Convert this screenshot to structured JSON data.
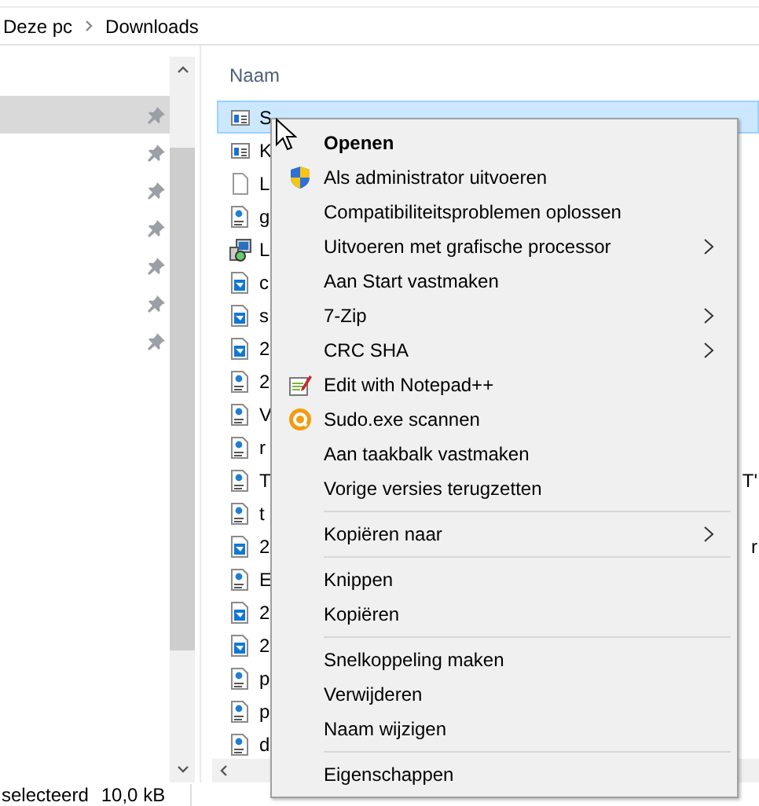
{
  "address_bar": {
    "path": [
      {
        "label": "Deze pc"
      },
      {
        "label": "Downloads"
      }
    ]
  },
  "navigation_pane": {
    "items": [
      {
        "selected": true
      },
      {
        "selected": false
      },
      {
        "selected": false
      },
      {
        "selected": false
      },
      {
        "selected": false
      },
      {
        "selected": false
      },
      {
        "selected": false
      }
    ]
  },
  "file_list": {
    "column_header": "Naam",
    "rows": [
      {
        "name": "S",
        "kind": "app",
        "selected": true
      },
      {
        "name": "K",
        "kind": "app",
        "selected": false
      },
      {
        "name": "L",
        "kind": "blank",
        "selected": false
      },
      {
        "name": "g",
        "kind": "pdf",
        "selected": false
      },
      {
        "name": "L",
        "kind": "installer",
        "selected": false
      },
      {
        "name": "c",
        "kind": "image",
        "selected": false
      },
      {
        "name": "s",
        "kind": "image",
        "selected": false
      },
      {
        "name": "2",
        "kind": "image",
        "selected": false
      },
      {
        "name": "2",
        "kind": "pdf",
        "selected": false
      },
      {
        "name": "V",
        "kind": "pdf",
        "selected": false
      },
      {
        "name": "r",
        "kind": "pdf",
        "selected": false
      },
      {
        "name": "T",
        "kind": "pdf",
        "selected": false,
        "column_2": "T'"
      },
      {
        "name": "t",
        "kind": "pdf",
        "selected": false
      },
      {
        "name": "2",
        "kind": "image",
        "selected": false,
        "column_2": "r"
      },
      {
        "name": "E",
        "kind": "pdf",
        "selected": false
      },
      {
        "name": "2",
        "kind": "image",
        "selected": false
      },
      {
        "name": "2",
        "kind": "image",
        "selected": false
      },
      {
        "name": "p",
        "kind": "pdf",
        "selected": false
      },
      {
        "name": "p",
        "kind": "pdf",
        "selected": false
      },
      {
        "name": "d",
        "kind": "pdf",
        "selected": false
      }
    ]
  },
  "status_bar": {
    "selection": "selecteerd",
    "size": "10,0 kB"
  },
  "context_menu": {
    "items": [
      {
        "kind": "item",
        "label": "Openen",
        "default": true,
        "submenu": false
      },
      {
        "kind": "shield",
        "label": "Als administrator uitvoeren",
        "default": false,
        "submenu": false
      },
      {
        "kind": "item",
        "label": "Compatibiliteitsproblemen oplossen",
        "default": false,
        "submenu": false
      },
      {
        "kind": "item",
        "label": "Uitvoeren met grafische processor",
        "default": false,
        "submenu": true
      },
      {
        "kind": "item",
        "label": "Aan Start vastmaken",
        "default": false,
        "submenu": false
      },
      {
        "kind": "item",
        "label": "7-Zip",
        "default": false,
        "submenu": true
      },
      {
        "kind": "item",
        "label": "CRC SHA",
        "default": false,
        "submenu": true
      },
      {
        "kind": "notepad",
        "label": "Edit with Notepad++",
        "default": false,
        "submenu": false
      },
      {
        "kind": "scanner",
        "label": "Sudo.exe scannen",
        "default": false,
        "submenu": false
      },
      {
        "kind": "item",
        "label": "Aan taakbalk vastmaken",
        "default": false,
        "submenu": false
      },
      {
        "kind": "item",
        "label": "Vorige versies terugzetten",
        "default": false,
        "submenu": false
      },
      {
        "kind": "separator"
      },
      {
        "kind": "item",
        "label": "Kopiëren naar",
        "default": false,
        "submenu": true
      },
      {
        "kind": "separator"
      },
      {
        "kind": "item",
        "label": "Knippen",
        "default": false,
        "submenu": false
      },
      {
        "kind": "item",
        "label": "Kopiëren",
        "default": false,
        "submenu": false
      },
      {
        "kind": "separator"
      },
      {
        "kind": "item",
        "label": "Snelkoppeling maken",
        "default": false,
        "submenu": false
      },
      {
        "kind": "item",
        "label": "Verwijderen",
        "default": false,
        "submenu": false
      },
      {
        "kind": "item",
        "label": "Naam wijzigen",
        "default": false,
        "submenu": false
      },
      {
        "kind": "separator"
      },
      {
        "kind": "item",
        "label": "Eigenschappen",
        "default": false,
        "submenu": false
      }
    ]
  }
}
